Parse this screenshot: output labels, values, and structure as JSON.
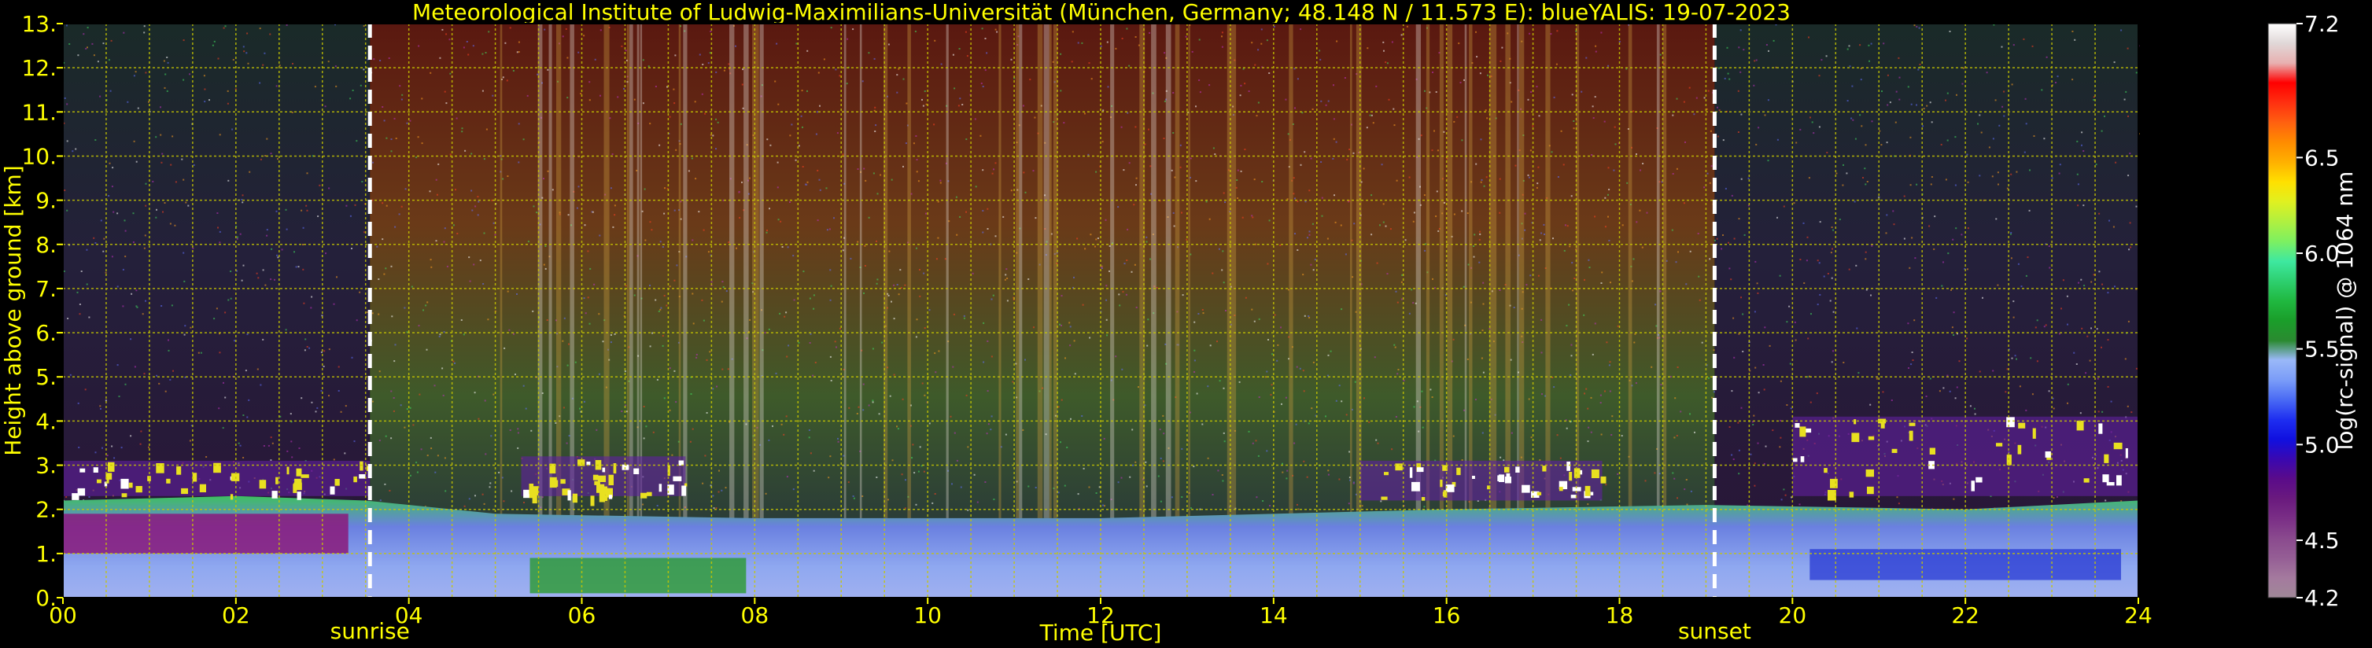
{
  "title": "Meteorological Institute of Ludwig-Maximilians-Universität (München, Germany; 48.148 N / 11.573 E):    blueYALIS: 19-07-2023",
  "colors": {
    "text": "#ffff00",
    "grid": "#c8c800",
    "background": "#000000",
    "marker_lines": "#ffffff",
    "colorbar_label": "#ffffff"
  },
  "chart_data": {
    "type": "heatmap",
    "title": "Meteorological Institute of Ludwig-Maximilians-Universität (München, Germany; 48.148 N / 11.573 E):    blueYALIS: 19-07-2023",
    "xlabel": "Time [UTC]",
    "ylabel": "Height above ground [km]",
    "xlim": [
      0,
      24
    ],
    "ylim": [
      0,
      13
    ],
    "grid": true,
    "x_ticks": [
      "00",
      "02",
      "04",
      "06",
      "08",
      "10",
      "12",
      "14",
      "16",
      "18",
      "20",
      "22",
      "24"
    ],
    "y_ticks": [
      "0.",
      "1.",
      "2.",
      "3.",
      "4.",
      "5.",
      "6.",
      "7.",
      "8.",
      "9.",
      "10.",
      "11.",
      "12.",
      "13."
    ],
    "annotations": [
      {
        "label": "sunrise",
        "x": 3.55
      },
      {
        "label": "sunset",
        "x": 19.1
      }
    ],
    "colorbar": {
      "label": "log(rc-signal) @ 1064 nm",
      "range": [
        4.2,
        7.2
      ],
      "tick_labels": [
        "4.2",
        "4.5",
        "5.0",
        "5.5",
        "6.0",
        "6.5",
        "7.2"
      ],
      "tick_values": [
        4.2,
        4.5,
        5.0,
        5.5,
        6.0,
        6.5,
        7.2
      ],
      "colors": [
        "#a08898",
        "#a47a9e",
        "#955e95",
        "#8a4a8e",
        "#7a2e86",
        "#6a1a7e",
        "#5a0b8a",
        "#3a08b0",
        "#1010e0",
        "#1e2ef0",
        "#4a6af4",
        "#7a9cf8",
        "#9ab8f8",
        "#2a8a30",
        "#1a9e2a",
        "#20b840",
        "#2ed070",
        "#3ee8a0",
        "#7ef060",
        "#b0f040",
        "#e0f020",
        "#ffe000",
        "#ffb000",
        "#ff8c00",
        "#ff6010",
        "#ff3010",
        "#ff0000",
        "#e8b0b0",
        "#e0d8d8",
        "#ffffff"
      ]
    },
    "cloud_layers": [
      {
        "t_start": 0,
        "t_end": 3.55,
        "base_km": 2.3,
        "top_km": 3.1
      },
      {
        "t_start": 5.3,
        "t_end": 7.2,
        "base_km": 2.3,
        "top_km": 3.2
      },
      {
        "t_start": 15.0,
        "t_end": 17.8,
        "base_km": 2.2,
        "top_km": 3.1
      },
      {
        "t_start": 20.0,
        "t_end": 24,
        "base_km": 2.3,
        "top_km": 4.1
      }
    ],
    "boundary_layer": [
      {
        "t": 0,
        "top_km": 2.2
      },
      {
        "t": 2,
        "top_km": 2.3
      },
      {
        "t": 3.5,
        "top_km": 2.2
      },
      {
        "t": 5,
        "top_km": 1.9
      },
      {
        "t": 8,
        "top_km": 1.8
      },
      {
        "t": 12,
        "top_km": 1.8
      },
      {
        "t": 16,
        "top_km": 2.0
      },
      {
        "t": 19,
        "top_km": 2.1
      },
      {
        "t": 22,
        "top_km": 2.0
      },
      {
        "t": 24,
        "top_km": 2.2
      }
    ]
  }
}
